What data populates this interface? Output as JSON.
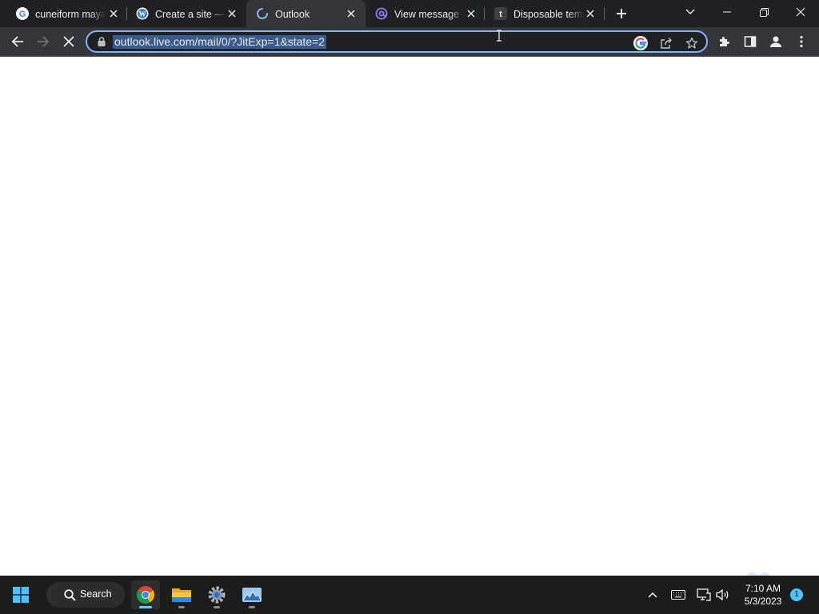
{
  "browser": {
    "tabs": [
      {
        "title": "cuneiform maya",
        "favicon": "google-icon",
        "active": false
      },
      {
        "title": "Create a site —",
        "favicon": "wordpress-icon",
        "active": false
      },
      {
        "title": "Outlook",
        "favicon": "loading-spinner-icon",
        "active": true
      },
      {
        "title": "View message -",
        "favicon": "at-sign-icon",
        "active": false
      },
      {
        "title": "Disposable temp",
        "favicon": "tempmail-t-icon",
        "active": false
      }
    ],
    "omnibox": {
      "url": "outlook.live.com/mail/0/?JitExp=1&state=2",
      "focused": true,
      "selected": true
    },
    "colors": {
      "tabstrip_bg": "#202124",
      "toolbar_bg": "#35363a",
      "focus_ring": "#8ab4f8",
      "url_selection": "#3c5a8c"
    },
    "page_state": "loading"
  },
  "taskbar": {
    "search_label": "Search",
    "apps": [
      "chrome-icon",
      "file-explorer-icon",
      "settings-icon",
      "photos-app-icon"
    ],
    "active_app": "chrome-icon",
    "clock": {
      "time": "7:10 AM",
      "date": "5/3/2023"
    },
    "notification_count": "1"
  }
}
